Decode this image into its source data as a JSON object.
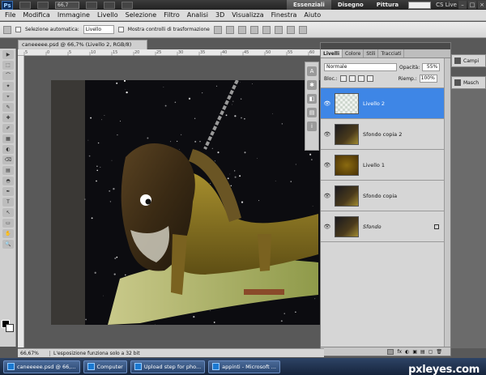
{
  "appbar": {
    "logo": "Ps",
    "zoom": "66,7",
    "workspaces": [
      "Essenziali",
      "Disegno",
      "Pittura"
    ],
    "cs_live": "CS Live",
    "window_buttons": [
      "–",
      "□",
      "×"
    ]
  },
  "menubar": {
    "items": [
      "File",
      "Modifica",
      "Immagine",
      "Livello",
      "Selezione",
      "Filtro",
      "Analisi",
      "3D",
      "Visualizza",
      "Finestra",
      "Aiuto"
    ]
  },
  "options": {
    "auto_select_label": "Selezione automatica:",
    "auto_select_value": "Livello",
    "show_transform_label": "Mostra controlli di trasformazione"
  },
  "document": {
    "tab_title": "caneeeee.psd @ 66,7% (Livello 2, RGB/8)",
    "ruler_marks": [
      "5",
      "0",
      "5",
      "10",
      "15",
      "20",
      "25",
      "30",
      "35",
      "40",
      "45",
      "50",
      "55",
      "60"
    ]
  },
  "tools": [
    "▶",
    "⬚",
    "⌒",
    "✦",
    "⌖",
    "✎",
    "✚",
    "✐",
    "▦",
    "◐",
    "⌫",
    "▤",
    "◓",
    "✒",
    "T",
    "↖",
    "▭",
    "✋",
    "🔍"
  ],
  "layers_panel": {
    "tabs": [
      "Livelli",
      "Colore",
      "Stili",
      "Tracciati"
    ],
    "blend_mode": "Normale",
    "opacity_label": "Opacità:",
    "opacity_value": "55%",
    "lock_label": "Bloc.:",
    "fill_label": "Riemp.:",
    "fill_value": "100%",
    "layers": [
      {
        "name": "Livello 2",
        "selected": true,
        "italic": false,
        "locked": false,
        "thumb": "transparent"
      },
      {
        "name": "Sfondo copia 2",
        "selected": false,
        "italic": false,
        "locked": false,
        "thumb": "art"
      },
      {
        "name": "Livello 1",
        "selected": false,
        "italic": false,
        "locked": false,
        "thumb": "gold"
      },
      {
        "name": "Sfondo copia",
        "selected": false,
        "italic": false,
        "locked": false,
        "thumb": "art"
      },
      {
        "name": "Sfondo",
        "selected": false,
        "italic": true,
        "locked": true,
        "thumb": "art"
      }
    ],
    "footer_icons": [
      "fx",
      "◐",
      "▣",
      "▤",
      "▢",
      "🗑"
    ]
  },
  "mini_panels": [
    "Campi",
    "Masch"
  ],
  "dock_icons": [
    "A",
    "✱",
    "◧",
    "▤",
    "i"
  ],
  "status": {
    "zoom": "66,67%",
    "message": "L'esposizione funziona solo a 32 bit"
  },
  "taskbar": {
    "items": [
      "caneeeee.psd @ 66,...",
      "Computer",
      "Upload step for pho...",
      "appinti - Microsoft ..."
    ]
  },
  "watermark": "pxleyes.com",
  "colors": {
    "accent_selected": "#3e86e6",
    "canvas_bg": "#595959"
  }
}
